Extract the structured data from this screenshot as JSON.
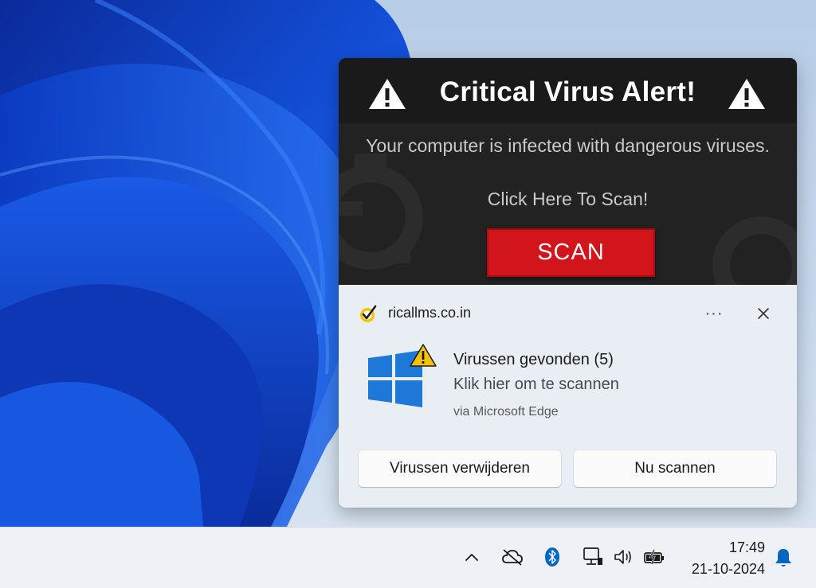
{
  "popup": {
    "title": "Critical Virus Alert!",
    "message": "Your computer is infected with dangerous viruses.",
    "prompt": "Click Here To Scan!",
    "scan_label": "SCAN",
    "warning_icon": "warning-triangle-icon",
    "button_color": "#d2141b"
  },
  "notification": {
    "source": "ricallms.co.in",
    "source_icon": "norton-check-icon",
    "more_label": "···",
    "close_icon": "close-icon",
    "app_icon": "windows-logo-icon",
    "title": "Virussen gevonden (5)",
    "body": "Klik hier om te scannen",
    "via": "via Microsoft Edge",
    "actions": [
      {
        "label": "Virussen verwijderen"
      },
      {
        "label": "Nu scannen"
      }
    ]
  },
  "taskbar": {
    "tray_icons": [
      "chevron-up-icon",
      "cloud-offline-icon",
      "bluetooth-icon",
      "network-icon",
      "volume-icon",
      "battery-charging-icon"
    ],
    "time": "17:49",
    "date": "21-10-2024",
    "notification_icon": "bell-icon",
    "accent": "#0067c0"
  }
}
